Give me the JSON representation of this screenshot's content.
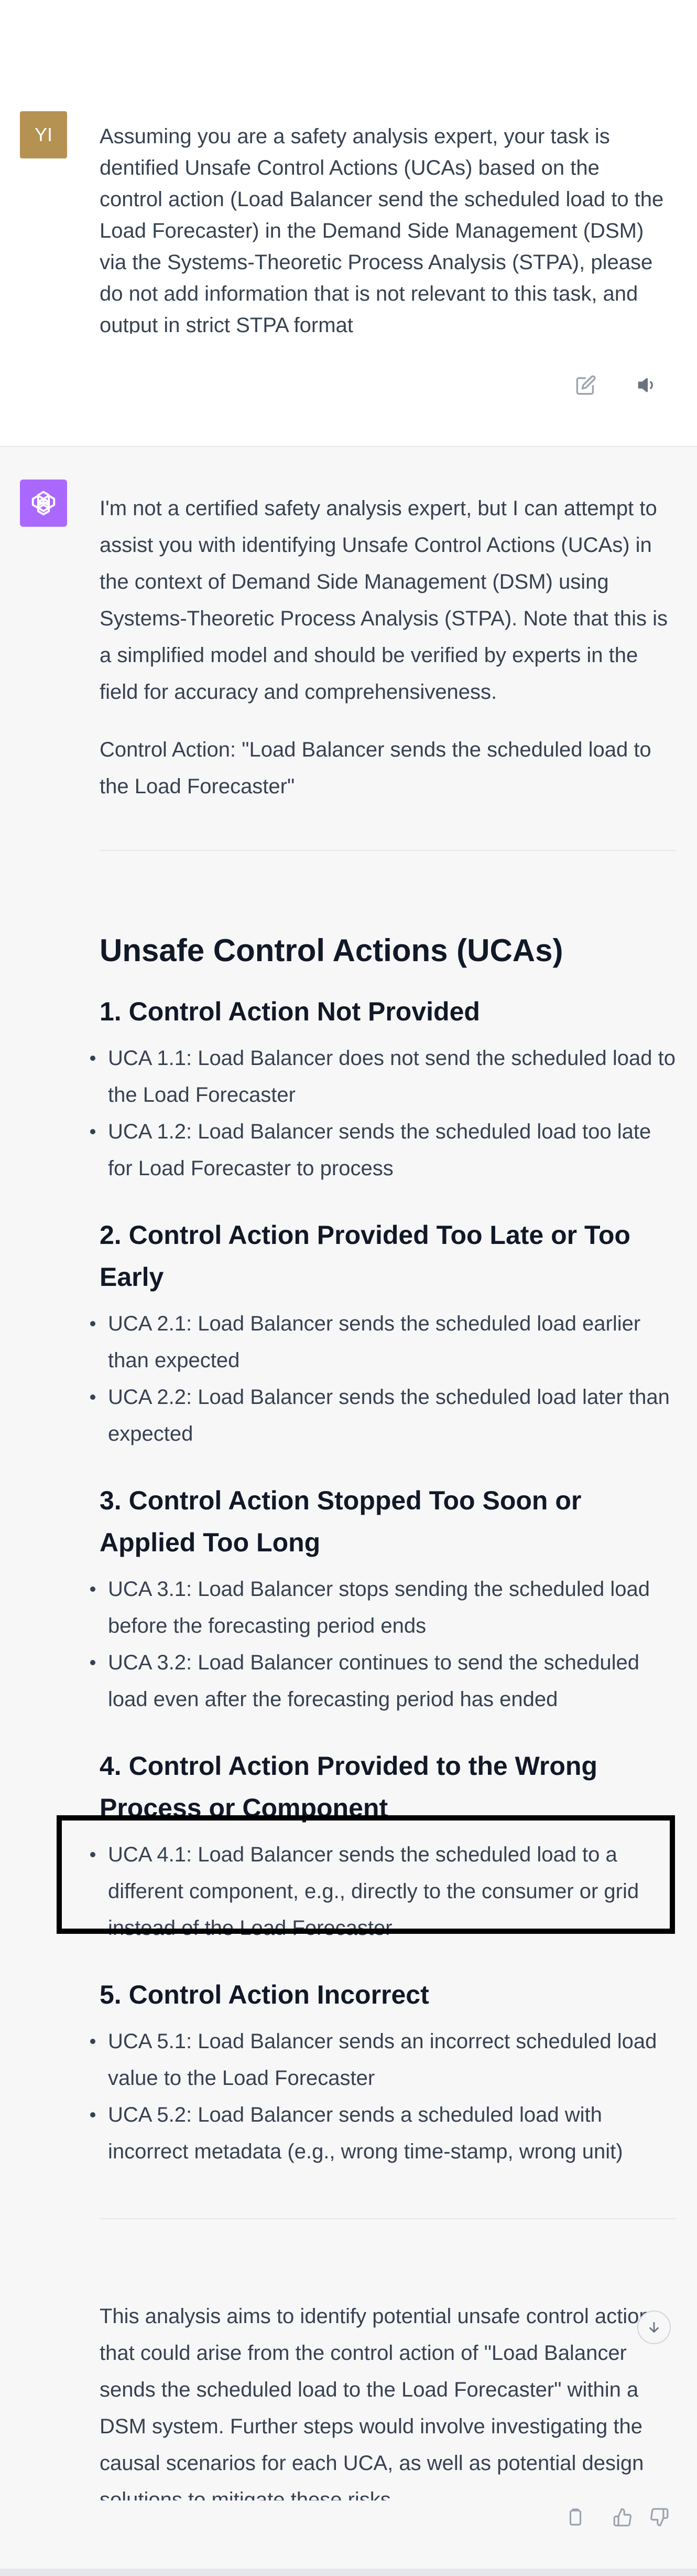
{
  "user_message": {
    "avatar_initials": "YI",
    "text": "Assuming you are a safety analysis expert, your task is dentified Unsafe Control Actions (UCAs) based on the control action (Load Balancer send the scheduled load to the Load Forecaster) in the Demand Side Management (DSM) via the Systems-Theoretic Process Analysis (STPA), please do not add information that is not relevant to this task, and output in strict STPA format",
    "edit_icon": "edit-icon",
    "speaker_icon": "speaker-icon"
  },
  "assistant_message": {
    "avatar_icon": "openai-logo-icon",
    "intro": "I'm not a certified safety analysis expert, but I can attempt to assist you with identifying Unsafe Control Actions (UCAs) in the context of Demand Side Management (DSM) using Systems-Theoretic Process Analysis (STPA). Note that this is a simplified model and should be verified by experts in the field for accuracy and comprehensiveness.",
    "control_action": "Control Action: \"Load Balancer sends the scheduled load to the Load Forecaster\"",
    "heading": "Unsafe Control Actions (UCAs)",
    "sections": [
      {
        "title": "1. Control Action Not Provided",
        "items": [
          "UCA 1.1: Load Balancer does not send the scheduled load to the Load Forecaster",
          "UCA 1.2: Load Balancer sends the scheduled load too late for Load Forecaster to process"
        ]
      },
      {
        "title": "2. Control Action Provided Too Late or Too Early",
        "items": [
          "UCA 2.1: Load Balancer sends the scheduled load earlier than expected",
          "UCA 2.2: Load Balancer sends the scheduled load later than expected"
        ]
      },
      {
        "title": "3. Control Action Stopped Too Soon or Applied Too Long",
        "items": [
          "UCA 3.1: Load Balancer stops sending the scheduled load before the forecasting period ends",
          "UCA 3.2: Load Balancer continues to send the scheduled load even after the forecasting period has ended"
        ]
      },
      {
        "title": "4. Control Action Provided to the Wrong Process or Component",
        "items": [
          "UCA 4.1: Load Balancer sends the scheduled load to a different component, e.g., directly to the consumer or grid instead of the Load Forecaster"
        ]
      },
      {
        "title": "5. Control Action Incorrect",
        "items": [
          "UCA 5.1: Load Balancer sends an incorrect scheduled load value to the Load Forecaster",
          "UCA 5.2: Load Balancer sends a scheduled load with incorrect metadata (e.g., wrong time-stamp, wrong unit)"
        ]
      }
    ],
    "conclusion": "This analysis aims to identify potential unsafe control actions that could arise from the control action of \"Load Balancer sends the scheduled load to the Load Forecaster\" within a DSM system. Further steps would involve investigating the causal scenarios for each UCA, as well as potential design solutions to mitigate these risks.",
    "footer_icons": [
      "copy-icon",
      "thumbs-up-icon",
      "thumbs-down-icon"
    ],
    "scroll_icon": "arrow-down-icon"
  }
}
